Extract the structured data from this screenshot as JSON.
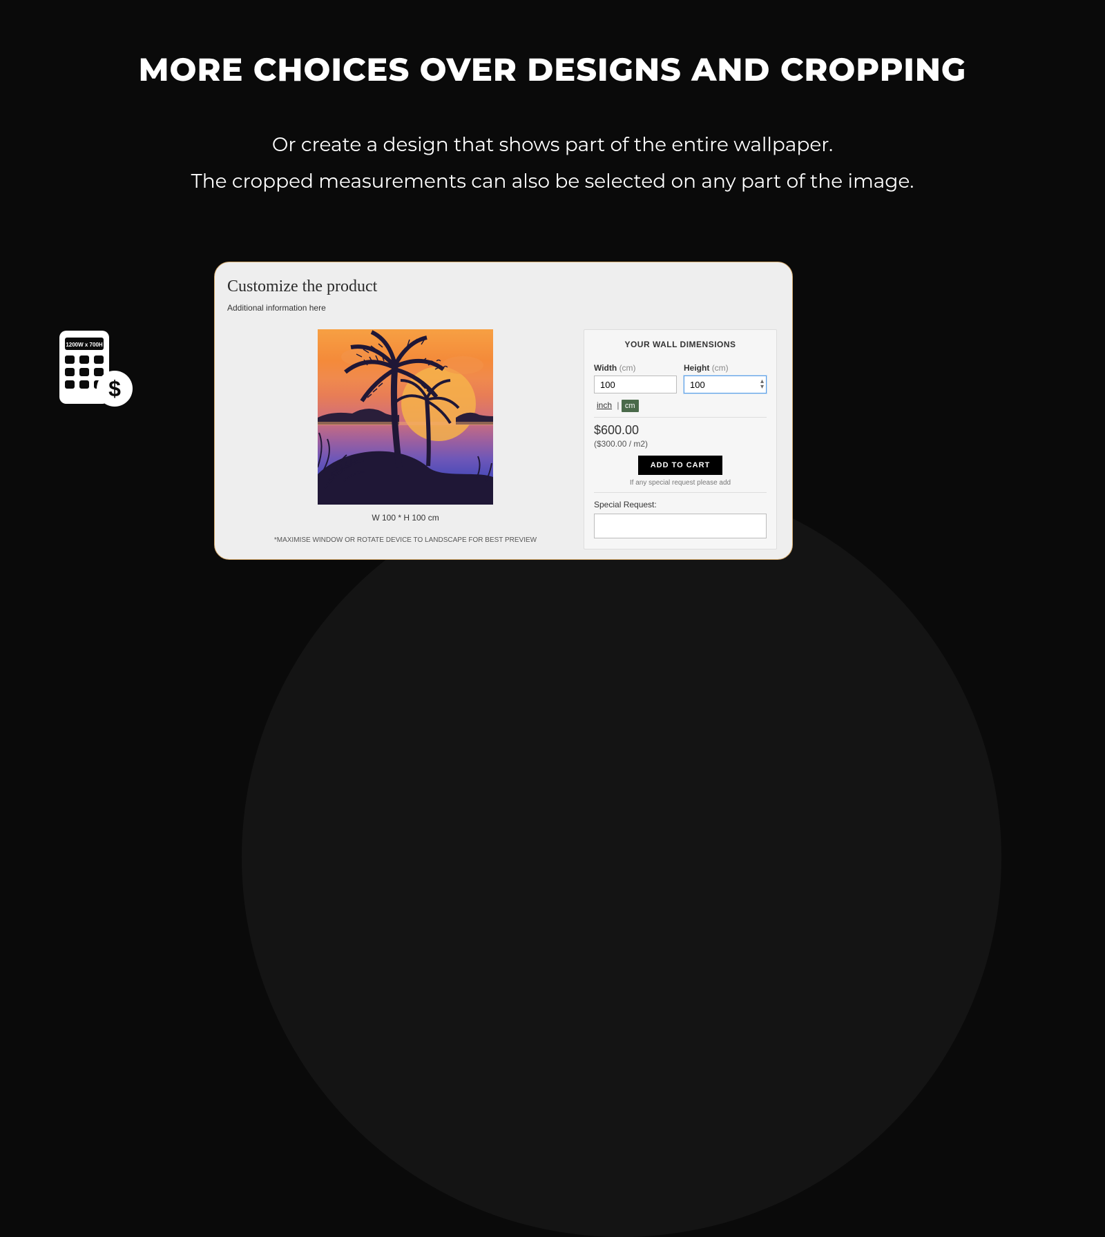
{
  "title": "MORE CHOICES OVER DESIGNS AND CROPPING",
  "subtitle_line1": "Or create a design that shows part of the entire wallpaper.",
  "subtitle_line2": "The cropped measurements can also be selected on any part of the image.",
  "calc_label": "1200W x 700H",
  "card": {
    "title": "Customize the product",
    "sub": "Additional information here",
    "preview_caption": "W 100 * H 100 cm",
    "preview_note": "*MAXIMISE WINDOW OR ROTATE DEVICE TO LANDSCAPE FOR BEST PREVIEW"
  },
  "dimensions": {
    "header": "YOUR WALL DIMENSIONS",
    "width_label": "Width",
    "width_unit": "(cm)",
    "width_value": "100",
    "height_label": "Height",
    "height_unit": "(cm)",
    "height_value": "100",
    "inch_label": "inch",
    "sep": "|",
    "cm_label": "cm",
    "price": "$600.00",
    "price_sub": "($300.00 / m2)",
    "add_to_cart": "ADD TO CART",
    "cart_note": "If any special request please add",
    "sr_label": "Special Request:"
  }
}
